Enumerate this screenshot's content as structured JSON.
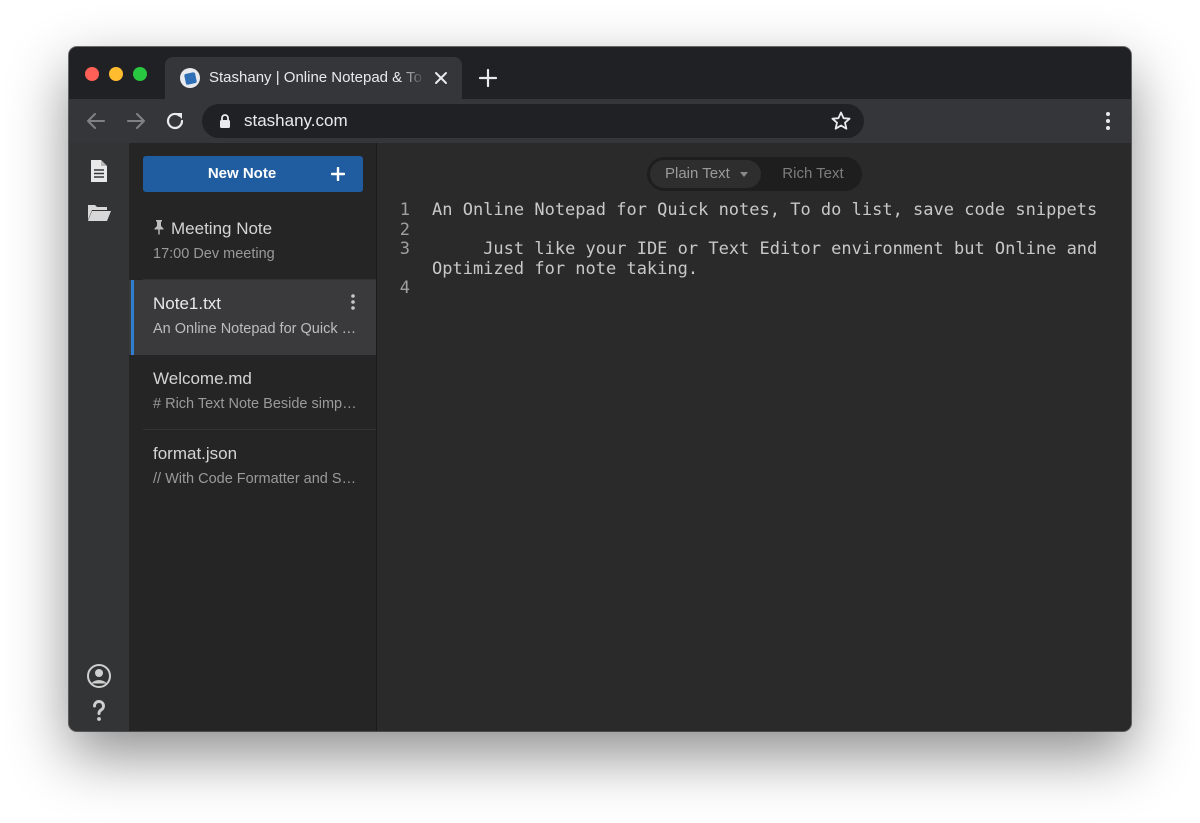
{
  "browser": {
    "tab_title": "Stashany | Online Notepad & To do list",
    "url": "stashany.com"
  },
  "sidebar": {
    "new_note_label": "New Note"
  },
  "notes": [
    {
      "title": "Meeting Note",
      "preview": "17:00 Dev meeting",
      "pinned": true
    },
    {
      "title": "Note1.txt",
      "preview": "An Online Notepad for Quick notes, To do list, save code snippets",
      "active": true
    },
    {
      "title": "Welcome.md",
      "preview": "# Rich Text Note Beside simple text"
    },
    {
      "title": "format.json",
      "preview": "// With Code Formatter and Syntax Highlighting"
    }
  ],
  "editor": {
    "mode_plain": "Plain Text",
    "mode_rich": "Rich Text",
    "lines": [
      {
        "number": "1",
        "text": "An Online Notepad for Quick notes, To do list, save code snippets"
      },
      {
        "number": "2",
        "text": ""
      },
      {
        "number": "3",
        "text": "     Just like your IDE or Text Editor environment but Online and Optimized for note taking."
      },
      {
        "number": "4",
        "text": ""
      }
    ]
  },
  "colors": {
    "accent": "#1f5da0",
    "active_indicator": "#2f7fd1",
    "editor_bg": "#2a2a2a"
  },
  "icons": [
    "document-icon",
    "folder-open-icon",
    "account-icon",
    "help-icon",
    "pin-icon",
    "kebab-icon",
    "lock-icon",
    "star-icon"
  ]
}
